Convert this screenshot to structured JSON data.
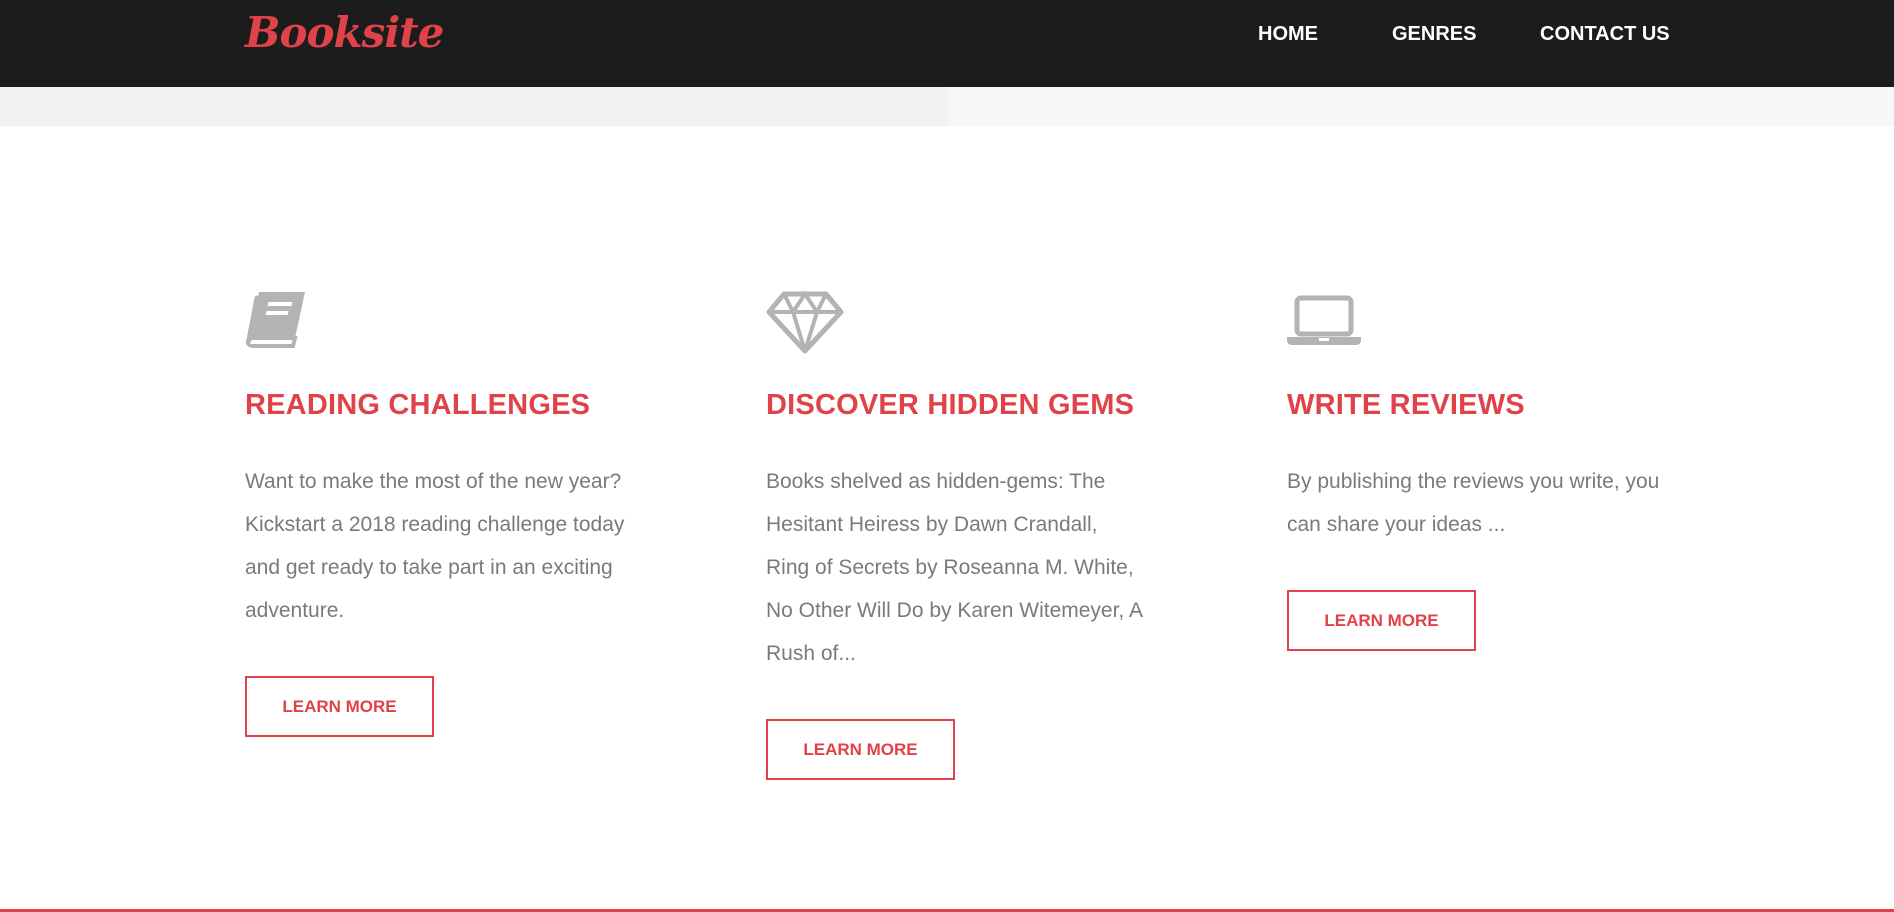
{
  "header": {
    "logo": "Booksite",
    "nav": [
      {
        "label": "HOME"
      },
      {
        "label": "GENRES"
      },
      {
        "label": "CONTACT US"
      }
    ]
  },
  "features": [
    {
      "icon": "book-icon",
      "title": "READING CHALLENGES",
      "text": "Want to make the most of the new year? Kickstart a 2018 reading challenge today and get ready to take part in an exciting adventure.",
      "button": "LEARN MORE"
    },
    {
      "icon": "diamond-icon",
      "title": "DISCOVER HIDDEN GEMS",
      "text": "Books shelved as hidden-gems: The Hesitant Heiress by Dawn Crandall, Ring of Secrets by Roseanna M. White, No Other Will Do by Karen Witemeyer, A Rush of...",
      "button": "LEARN MORE"
    },
    {
      "icon": "laptop-icon",
      "title": "WRITE REVIEWS",
      "text": "By publishing the reviews you write, you can share your ideas ...",
      "button": "LEARN MORE"
    }
  ],
  "colors": {
    "accent": "#e04249",
    "header_bg": "#1c1c1c",
    "icon": "#b3b3b3",
    "body_text": "#7a7a7a"
  }
}
